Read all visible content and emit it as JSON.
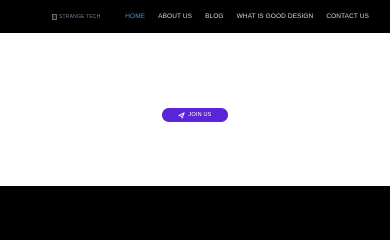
{
  "header": {
    "logo_alt": "STRANGE TECH",
    "nav": [
      {
        "label": "HOME",
        "active": true
      },
      {
        "label": "ABOUT US",
        "active": false
      },
      {
        "label": "BLOG",
        "active": false
      },
      {
        "label": "WHAT IS GOOD DESIGN",
        "active": false
      },
      {
        "label": "CONTACT US",
        "active": false
      }
    ]
  },
  "hero": {
    "cta_label": "JOIN US",
    "cta_icon": "send-icon"
  },
  "colors": {
    "background": "#000000",
    "hero_background": "#ffffff",
    "accent": "#5b24d6",
    "nav_active": "#4e8de0",
    "nav_text": "#d9d9d9"
  }
}
